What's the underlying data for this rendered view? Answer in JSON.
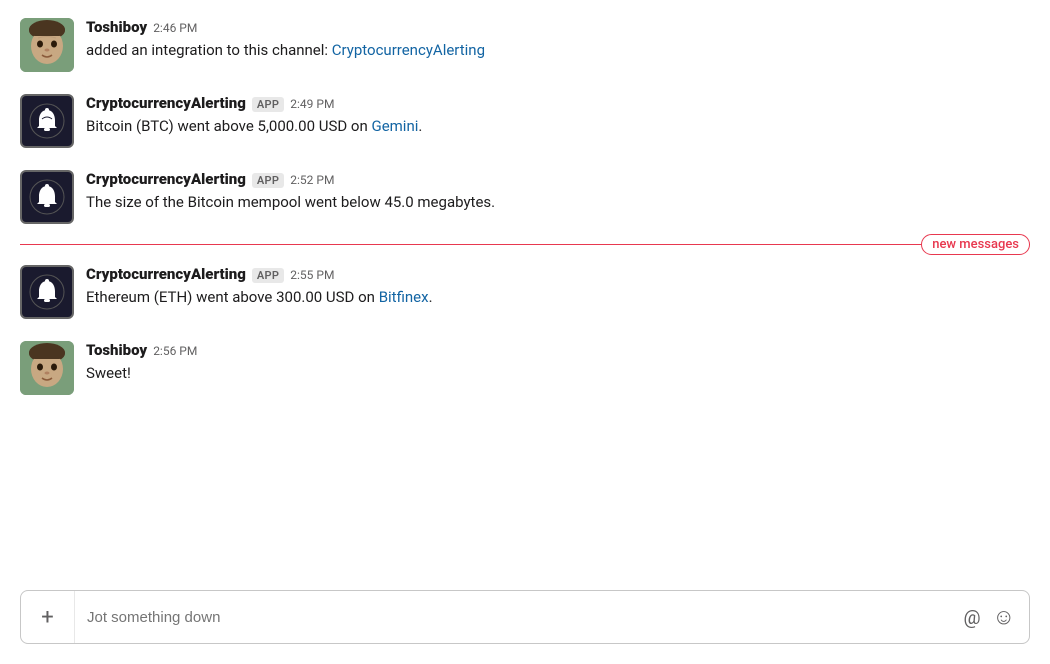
{
  "messages": [
    {
      "id": "msg1",
      "sender": "Toshiboy",
      "senderType": "user",
      "time": "2:46 PM",
      "text_before_link": "added an integration to this channel: ",
      "link_text": "CryptocurrencyAlerting",
      "text_after_link": "",
      "has_link": true,
      "link_href": "#"
    },
    {
      "id": "msg2",
      "sender": "CryptocurrencyAlerting",
      "senderType": "app",
      "time": "2:49 PM",
      "text_before_link": "Bitcoin (BTC) went above 5,000.00 USD on ",
      "link_text": "Gemini",
      "text_after_link": ".",
      "has_link": true,
      "link_href": "#"
    },
    {
      "id": "msg3",
      "sender": "CryptocurrencyAlerting",
      "senderType": "app",
      "time": "2:52 PM",
      "text_before_link": "The size of the Bitcoin mempool went below 45.0 megabytes.",
      "link_text": "",
      "text_after_link": "",
      "has_link": false,
      "link_href": ""
    },
    {
      "id": "msg4",
      "sender": "CryptocurrencyAlerting",
      "senderType": "app",
      "time": "2:55 PM",
      "text_before_link": "Ethereum (ETH) went above 300.00 USD on ",
      "link_text": "Bitfinex",
      "text_after_link": ".",
      "has_link": true,
      "link_href": "#"
    },
    {
      "id": "msg5",
      "sender": "Toshiboy",
      "senderType": "user",
      "time": "2:56 PM",
      "text_before_link": "Sweet!",
      "link_text": "",
      "text_after_link": "",
      "has_link": false,
      "link_href": ""
    }
  ],
  "new_messages_label": "new messages",
  "new_messages_divider_after_index": 2,
  "app_badge_label": "APP",
  "input": {
    "placeholder": "Jot something down",
    "plus_label": "+",
    "at_label": "@",
    "emoji_label": "☺"
  },
  "colors": {
    "link": "#1264a3",
    "new_messages_red": "#e8384f",
    "sender_name": "#1d1c1d",
    "timestamp": "#616061",
    "app_badge_bg": "#e8e8e8",
    "app_badge_text": "#616061"
  }
}
